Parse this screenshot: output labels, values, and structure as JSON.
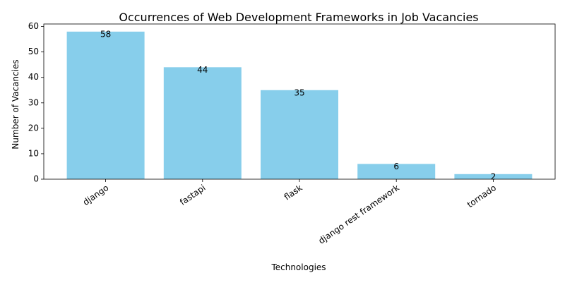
{
  "chart_data": {
    "type": "bar",
    "title": "Occurrences of Web Development Frameworks in Job Vacancies",
    "xlabel": "Technologies",
    "ylabel": "Number of Vacancies",
    "categories": [
      "django",
      "fastapi",
      "flask",
      "django rest framework",
      "tornado"
    ],
    "values": [
      58,
      44,
      35,
      6,
      2
    ],
    "ylim": [
      0,
      61
    ],
    "yticks": [
      0,
      10,
      20,
      30,
      40,
      50,
      60
    ],
    "bar_color": "#87CEEB",
    "grid": false,
    "legend": "none",
    "data_labels": true
  }
}
